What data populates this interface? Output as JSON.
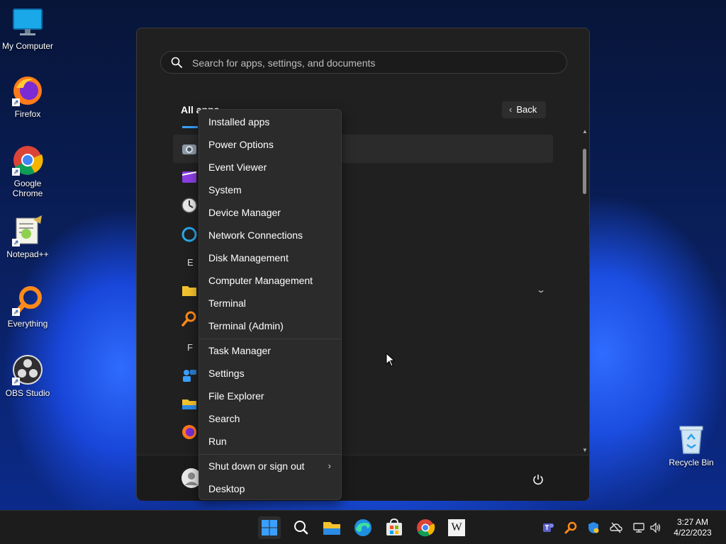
{
  "desktop": {
    "icons": [
      {
        "label": "My Computer",
        "icon": "monitor-icon"
      },
      {
        "label": "Firefox",
        "icon": "firefox-icon"
      },
      {
        "label": "Google\nChrome",
        "icon": "chrome-icon"
      },
      {
        "label": "Notepad++",
        "icon": "notepadpp-icon"
      },
      {
        "label": "Everything",
        "icon": "everything-icon"
      },
      {
        "label": "OBS Studio",
        "icon": "obs-icon"
      }
    ],
    "recycle_bin": "Recycle Bin"
  },
  "start_menu": {
    "search_placeholder": "Search for apps, settings, and documents",
    "all_apps_label": "All apps",
    "back_label": "Back",
    "section_letters": [
      "E",
      "F"
    ]
  },
  "context_menu": {
    "items": [
      "Installed apps",
      "Power Options",
      "Event Viewer",
      "System",
      "Device Manager",
      "Network Connections",
      "Disk Management",
      "Computer Management",
      "Terminal",
      "Terminal (Admin)",
      "Task Manager",
      "Settings",
      "File Explorer",
      "Search",
      "Run",
      "Shut down or sign out",
      "Desktop"
    ]
  },
  "taskbar": {
    "apps": [
      "start-icon",
      "search-icon",
      "file-explorer-icon",
      "edge-icon",
      "store-icon",
      "chrome-icon",
      "wikipedia-icon"
    ],
    "wiki_glyph": "W",
    "time": "3:27 AM",
    "date": "4/22/2023"
  },
  "colors": {
    "menu_bg": "#202020",
    "context_bg": "#2b2b2b",
    "accent": "#3aa0ff"
  }
}
